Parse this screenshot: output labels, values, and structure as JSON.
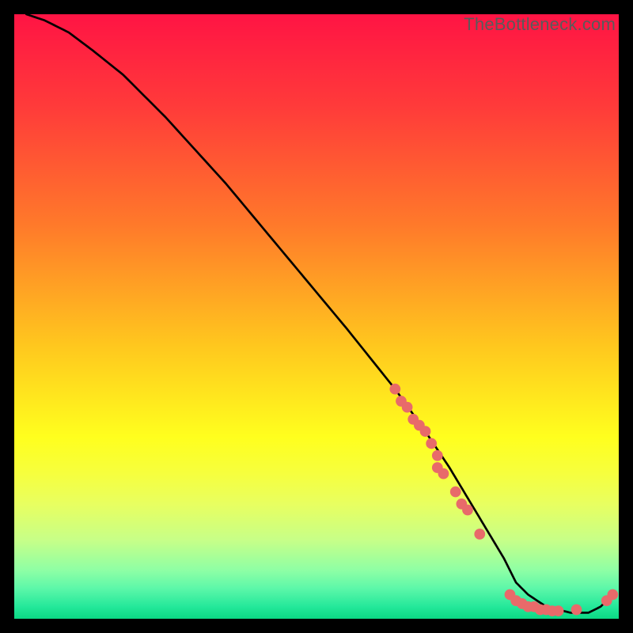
{
  "watermark": "TheBottleneck.com",
  "chart_data": {
    "type": "line",
    "title": "",
    "xlabel": "",
    "ylabel": "",
    "xlim": [
      0,
      100
    ],
    "ylim": [
      0,
      100
    ],
    "grid": false,
    "legend": false,
    "gradient_stops": [
      {
        "offset": 0.0,
        "color": "#ff1444"
      },
      {
        "offset": 0.15,
        "color": "#ff3a3a"
      },
      {
        "offset": 0.35,
        "color": "#ff7a2a"
      },
      {
        "offset": 0.55,
        "color": "#ffc81e"
      },
      {
        "offset": 0.7,
        "color": "#ffff1e"
      },
      {
        "offset": 0.76,
        "color": "#f6ff3e"
      },
      {
        "offset": 0.81,
        "color": "#e8ff60"
      },
      {
        "offset": 0.87,
        "color": "#c7ff88"
      },
      {
        "offset": 0.92,
        "color": "#8effa5"
      },
      {
        "offset": 0.95,
        "color": "#5cf7a9"
      },
      {
        "offset": 0.98,
        "color": "#24e89a"
      },
      {
        "offset": 1.0,
        "color": "#0bd884"
      }
    ],
    "series": [
      {
        "name": "bottleneck-curve",
        "color": "#000000",
        "x": [
          2,
          5,
          9,
          13,
          18,
          25,
          35,
          45,
          55,
          63,
          68,
          72,
          75,
          78,
          81,
          83,
          85,
          88,
          92,
          95,
          97,
          99
        ],
        "values": [
          100,
          99,
          97,
          94,
          90,
          83,
          72,
          60,
          48,
          38,
          31,
          25,
          20,
          15,
          10,
          6,
          4,
          2,
          1,
          1,
          2,
          4
        ]
      }
    ],
    "markers": {
      "name": "highlight-points",
      "color": "#e86a6a",
      "radius": 5,
      "points": [
        {
          "x": 63,
          "y": 38
        },
        {
          "x": 64,
          "y": 36
        },
        {
          "x": 65,
          "y": 35
        },
        {
          "x": 66,
          "y": 33
        },
        {
          "x": 67,
          "y": 32
        },
        {
          "x": 68,
          "y": 31
        },
        {
          "x": 69,
          "y": 29
        },
        {
          "x": 70,
          "y": 27
        },
        {
          "x": 70,
          "y": 25
        },
        {
          "x": 71,
          "y": 24
        },
        {
          "x": 73,
          "y": 21
        },
        {
          "x": 74,
          "y": 19
        },
        {
          "x": 75,
          "y": 18
        },
        {
          "x": 77,
          "y": 14
        },
        {
          "x": 82,
          "y": 4
        },
        {
          "x": 83,
          "y": 3
        },
        {
          "x": 84,
          "y": 2.5
        },
        {
          "x": 85,
          "y": 2
        },
        {
          "x": 86,
          "y": 2
        },
        {
          "x": 87,
          "y": 1.5
        },
        {
          "x": 88,
          "y": 1.5
        },
        {
          "x": 89,
          "y": 1.3
        },
        {
          "x": 90,
          "y": 1.3
        },
        {
          "x": 93,
          "y": 1.5
        },
        {
          "x": 98,
          "y": 3
        },
        {
          "x": 99,
          "y": 4
        }
      ]
    }
  }
}
